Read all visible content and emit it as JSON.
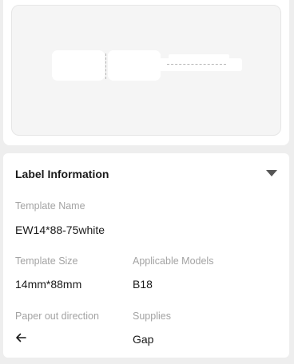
{
  "section": {
    "title": "Label Information"
  },
  "fields": {
    "template_name": {
      "label": "Template Name",
      "value": "EW14*88-75white"
    },
    "template_size": {
      "label": "Template Size",
      "value": "14mm*88mm"
    },
    "applicable_models": {
      "label": "Applicable Models",
      "value": "B18"
    },
    "paper_out_direction": {
      "label": "Paper out direction",
      "icon": "left-arrow-icon"
    },
    "supplies": {
      "label": "Supplies",
      "value": "Gap"
    }
  },
  "colors": {
    "background": "#eeeeee",
    "card": "#ffffff",
    "preview_area": "#f5f5f5",
    "label_text": "#a3a3a3",
    "value_text": "#1a1a1a"
  }
}
